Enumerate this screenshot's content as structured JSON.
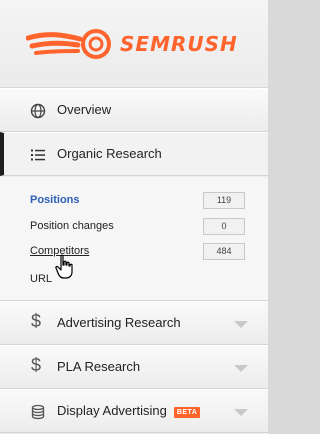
{
  "logo": {
    "text": "SEMRUSH",
    "brand_color": "#ff642d"
  },
  "nav": {
    "overview": {
      "label": "Overview",
      "icon": "globe-icon"
    },
    "organic": {
      "label": "Organic Research",
      "icon": "list-icon"
    },
    "advertising": {
      "label": "Advertising Research",
      "icon": "dollar-icon"
    },
    "pla": {
      "label": "PLA Research",
      "icon": "dollar-icon"
    },
    "display": {
      "label": "Display Advertising",
      "icon": "database-icon",
      "badge": "BETA"
    }
  },
  "organic_submenu": [
    {
      "label": "Positions",
      "count": "119",
      "active": true
    },
    {
      "label": "Position changes",
      "count": "0"
    },
    {
      "label": "Competitors",
      "count": "484"
    },
    {
      "label": "URL"
    }
  ],
  "colors": {
    "active_link": "#2b5fb8",
    "active_marker": "#1e1e1e"
  }
}
